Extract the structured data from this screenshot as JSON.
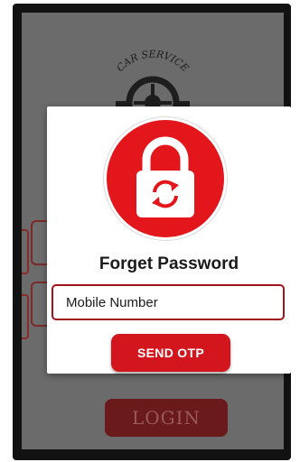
{
  "background_app": {
    "logo_text": "CAR SERVICE",
    "login_label": "LOGIN"
  },
  "modal": {
    "title": "Forget Password",
    "mobile_input": {
      "placeholder": "Mobile Number",
      "value": ""
    },
    "send_label": "SEND OTP"
  },
  "colors": {
    "accent": "#e3161c",
    "button": "#d3161e",
    "input_border": "#a3131a",
    "overlay": "#6b6b6b"
  },
  "icons": {
    "lock": "lock-refresh-icon",
    "field_icon": "user-icon"
  }
}
